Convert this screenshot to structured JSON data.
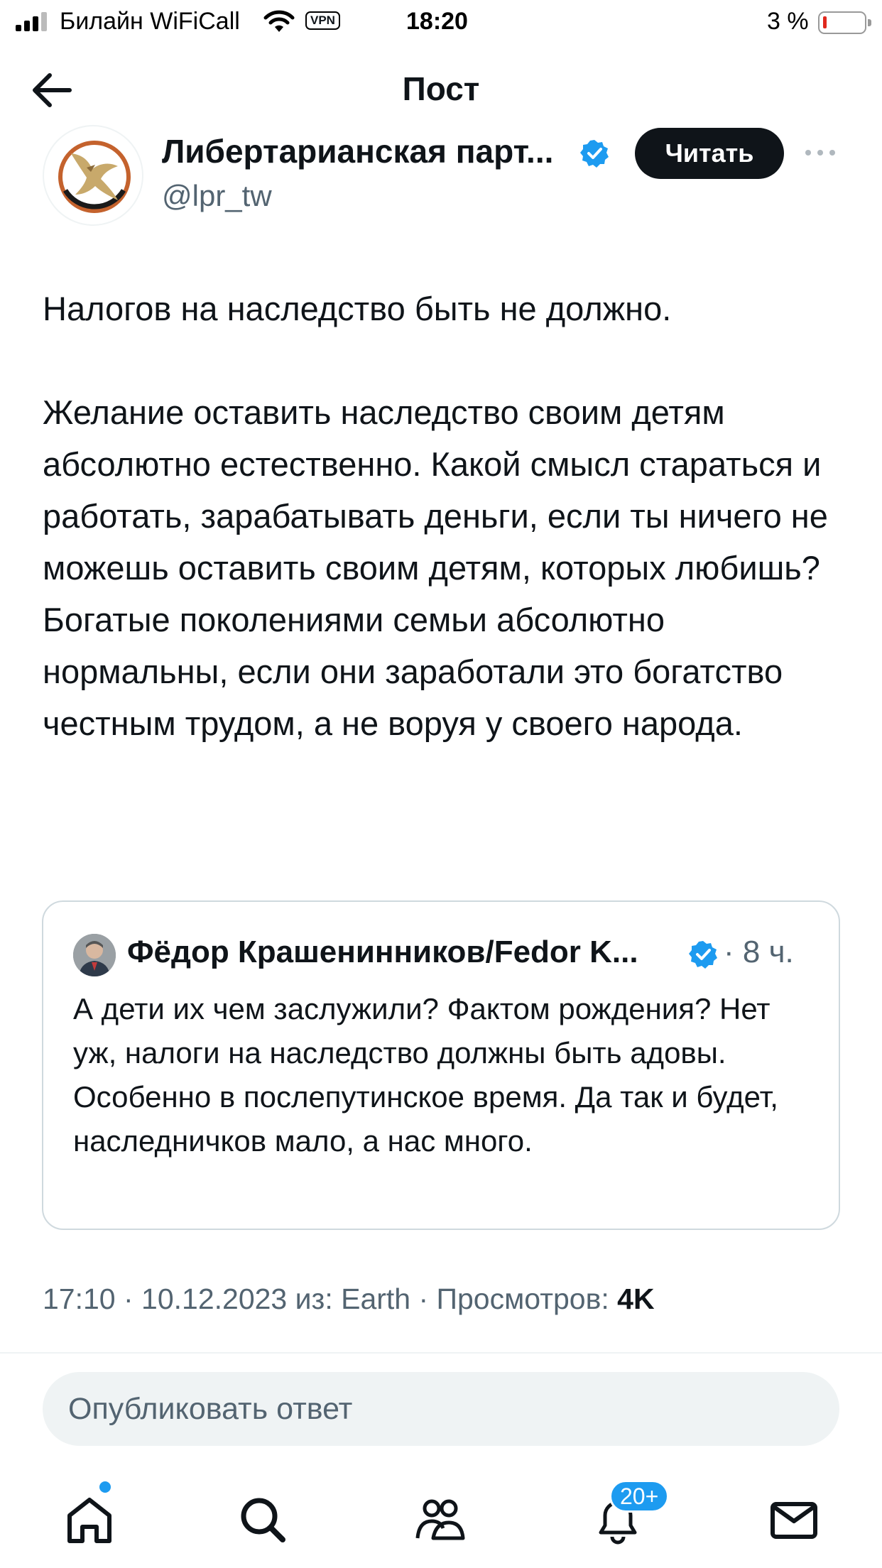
{
  "status_bar": {
    "carrier": "Билайн WiFiCall",
    "vpn": "VPN",
    "time": "18:20",
    "battery_percent": "3 %",
    "battery_level": 0.03
  },
  "header": {
    "title": "Пост"
  },
  "post": {
    "author_name": "Либертарианская парт...",
    "author_handle": "@lpr_tw",
    "follow_label": "Читать",
    "paragraphs": [
      "Налогов на наследство быть не должно.",
      "Желание оставить наследство своим детям абсолютно естественно. Какой смысл стараться и работать, зарабатывать деньги, если ты ничего не можешь оставить своим детям, которых любишь? Богатые поколениями семьи абсолютно нормальны, если они заработали это богатство честным трудом, а не воруя у своего народа."
    ],
    "meta_prefix": "17:10 · 10.12.2023 из: Earth · Просмотров:",
    "views": "4K"
  },
  "quote": {
    "author_name": "Фёдор Крашенинников/Fedor K...",
    "time": "· 8 ч.",
    "text": "А дети их чем заслужили? Фактом рождения? Нет уж, налоги на наследство должны быть  адовы. Особенно в послепутинское время. Да так и будет, наследничков мало, а нас много."
  },
  "reply": {
    "placeholder": "Опубликовать ответ"
  },
  "tabbar": {
    "notifications_badge": "20+"
  },
  "colors": {
    "text": "#0f1419",
    "secondary": "#536471",
    "accent": "#1d9bf0",
    "border": "#cfd9de"
  }
}
